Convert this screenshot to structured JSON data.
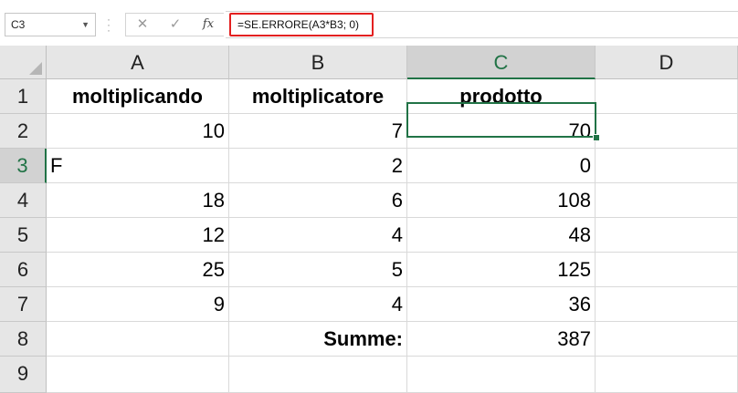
{
  "formula_bar": {
    "name_box": "C3",
    "cancel_icon": "✕",
    "confirm_icon": "✓",
    "function_icon": "fx",
    "formula": "=SE.ERRORE(A3*B3; 0)"
  },
  "columns": [
    "A",
    "B",
    "C",
    "D"
  ],
  "active_column": "C",
  "rows": [
    {
      "num": "1",
      "cells": [
        "moltiplicando",
        "moltiplicatore",
        "prodotto",
        ""
      ]
    },
    {
      "num": "2",
      "cells": [
        "10",
        "7",
        "70",
        ""
      ]
    },
    {
      "num": "3",
      "cells": [
        "F",
        "2",
        "0",
        ""
      ]
    },
    {
      "num": "4",
      "cells": [
        "18",
        "6",
        "108",
        ""
      ]
    },
    {
      "num": "5",
      "cells": [
        "12",
        "4",
        "48",
        ""
      ]
    },
    {
      "num": "6",
      "cells": [
        "25",
        "5",
        "125",
        ""
      ]
    },
    {
      "num": "7",
      "cells": [
        "9",
        "4",
        "36",
        ""
      ]
    },
    {
      "num": "8",
      "cells": [
        "",
        "Summe:",
        "387",
        ""
      ]
    },
    {
      "num": "9",
      "cells": [
        "",
        "",
        "",
        ""
      ]
    }
  ],
  "active_cell": "C3",
  "colors": {
    "accent": "#217346",
    "highlight_border": "#e32020"
  }
}
